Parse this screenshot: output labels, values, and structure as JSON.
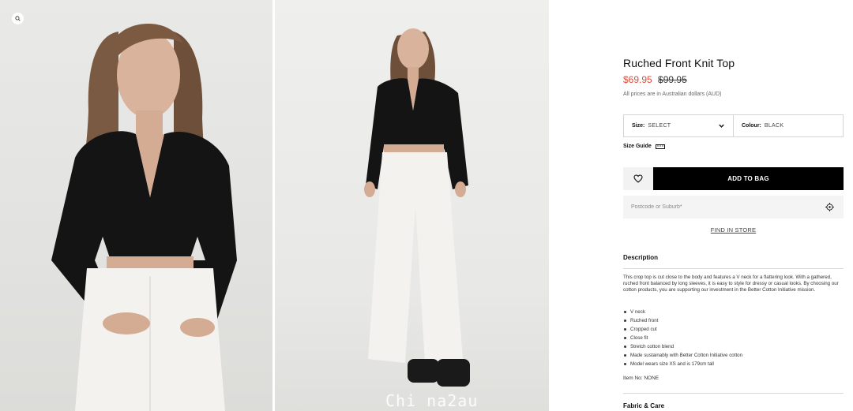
{
  "gallery": {
    "images": [
      {
        "alt": "Model wearing Ruched Front Knit Top, close crop"
      },
      {
        "alt": "Model wearing Ruched Front Knit Top, full length"
      }
    ],
    "watermark": "Chi na2au"
  },
  "product": {
    "title": "Ruched Front Knit Top",
    "price_sale": "$69.95",
    "price_original": "$99.95",
    "price_note": "All prices are in Australian dollars (AUD)",
    "size_label": "Size:",
    "size_value": "SELECT",
    "colour_label": "Colour:",
    "colour_value": "BLACK",
    "size_guide": "Size Guide",
    "add_to_bag": "ADD TO BAG",
    "postcode_placeholder": "Postcode or Suburb*",
    "find_in_store": "FIND IN STORE"
  },
  "description": {
    "heading": "Description",
    "text": "This crop top is cut close to the body and features a V neck for a flattering look. With a gathered, ruched front balanced by long sleeves, it is easy to style for dressy or casual looks. By choosing our cotton products, you are supporting our investment in the Better Cotton Initiative mission.",
    "bullets": [
      "V neck",
      "Ruched front",
      "Cropped cut",
      "Close fit",
      "Stretch cotton blend",
      "Made sustainably with Better Cotton Initiative cotton",
      "Model wears size XS and is 179cm tall"
    ],
    "item_no": "Item No: NONE"
  },
  "fabric": {
    "heading": "Fabric & Care"
  },
  "colors": {
    "sale_price": "#e04a3a",
    "button_bg": "#000000",
    "top_color": "#141414",
    "pants_color": "#f3f2ee"
  },
  "icons": {
    "zoom": "search-icon",
    "wishlist": "heart-icon",
    "size_guide": "ruler-icon",
    "locate": "crosshair-icon",
    "dropdown": "chevron-down-icon"
  }
}
